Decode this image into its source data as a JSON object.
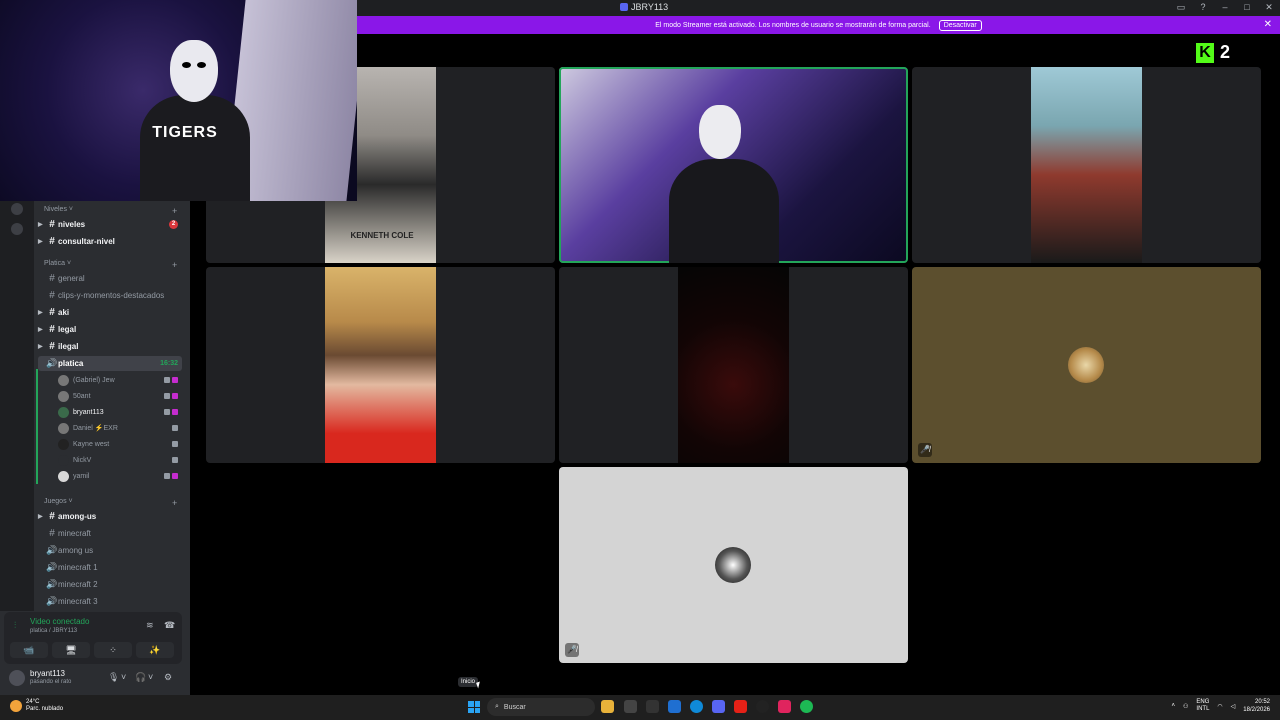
{
  "window": {
    "title": "JBRY113",
    "controls": [
      "▭",
      "?",
      "–",
      "□",
      "✕"
    ]
  },
  "banner": {
    "message": "El modo Streamer está activado. Los nombres de usuario se mostrarán de forma parcial.",
    "button": "Desactivar",
    "close": "✕"
  },
  "kick_overlay": {
    "logo": "K",
    "count": "2"
  },
  "webcam_overlay": {
    "jersey_text": "TIGERS"
  },
  "sidebar": {
    "categories": [
      {
        "label": "Niveles ˅",
        "add": "+"
      },
      {
        "label": "Platica ˅",
        "add": "+"
      },
      {
        "label": "Juegos ˅",
        "add": "+"
      }
    ],
    "channels_niveles": [
      {
        "name": "niveles",
        "badge": "2"
      },
      {
        "name": "consultar-nivel"
      }
    ],
    "channels_platica": [
      {
        "name": "general"
      },
      {
        "name": "clips-y-momentos-destacados"
      },
      {
        "name": "aki"
      },
      {
        "name": "legal"
      },
      {
        "name": "ilegal"
      }
    ],
    "active_voice": {
      "name": "platica",
      "time": "16:32"
    },
    "voice_users": [
      {
        "name": "(Gabriel) Jew"
      },
      {
        "name": "50ant"
      },
      {
        "name": "bryant113"
      },
      {
        "name": "Daniel ⚡EXR"
      },
      {
        "name": "Kayne west"
      },
      {
        "name": "NickV"
      },
      {
        "name": "yamil"
      }
    ],
    "channels_juegos": [
      {
        "name": "among-us"
      },
      {
        "name": "minecraft"
      },
      {
        "name": "among us"
      },
      {
        "name": "minecraft 1"
      },
      {
        "name": "minecraft 2"
      },
      {
        "name": "minecraft 3"
      }
    ],
    "icons": {
      "hash": "#",
      "speaker": "🔊",
      "arrow": "▶"
    }
  },
  "voice_panel": {
    "status": "Video conectado",
    "channel": "platica / JBRY113",
    "buttons": [
      "📹",
      "🖥",
      "⁘",
      "✨"
    ]
  },
  "user": {
    "name": "bryant113",
    "status": "pasando el rato",
    "controls": [
      "🎙",
      "˅",
      "🎧",
      "˅",
      "⚙"
    ]
  },
  "tiles": {
    "clothing_text": "KENNETH COLE",
    "mute_icon": "🎤̸"
  },
  "tooltip": {
    "label": "Inicio"
  },
  "taskbar": {
    "weather_temp": "24°C",
    "weather_desc": "Parc. nublado",
    "search_placeholder": "Buscar",
    "language": "ENG",
    "layout": "INTL",
    "time": "20:52",
    "date": "18/2/2026",
    "tray_arrow": "˄"
  },
  "colors": {
    "banner": "#8a17e8",
    "speaking_outline": "#23a55a",
    "kick_green": "#53fc18",
    "sidebar": "#2b2d31"
  }
}
